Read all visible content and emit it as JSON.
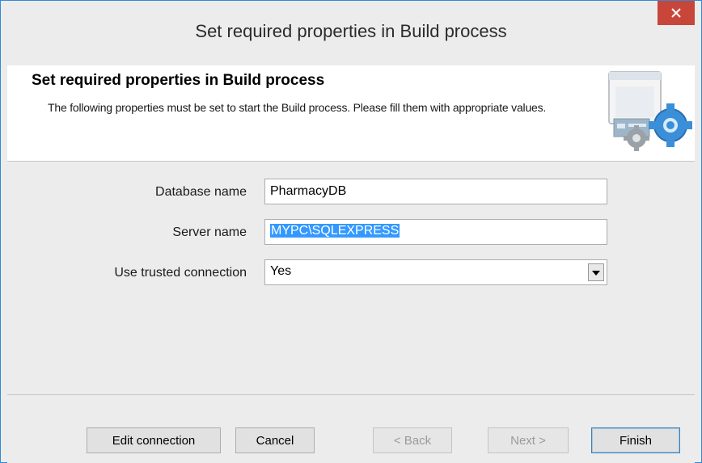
{
  "window": {
    "title": "Set required properties in Build process",
    "close_icon": "close-icon"
  },
  "header": {
    "title": "Set required properties in Build process",
    "description": "The following properties must be set to start the Build process. Please fill them with appropriate values.",
    "graphic_icon": "window-gear-icon"
  },
  "fields": {
    "database": {
      "label": "Database name",
      "value": "PharmacyDB"
    },
    "server": {
      "label": "Server name",
      "value": "MYPC\\SQLEXPRESS"
    },
    "trusted": {
      "label": "Use trusted connection",
      "value": "Yes"
    }
  },
  "buttons": {
    "edit_connection": "Edit connection",
    "cancel": "Cancel",
    "back": "< Back",
    "next": "Next >",
    "finish": "Finish"
  },
  "colors": {
    "close_button": "#c8453a",
    "window_border": "#2e8bd8",
    "selection": "#3399ff"
  }
}
